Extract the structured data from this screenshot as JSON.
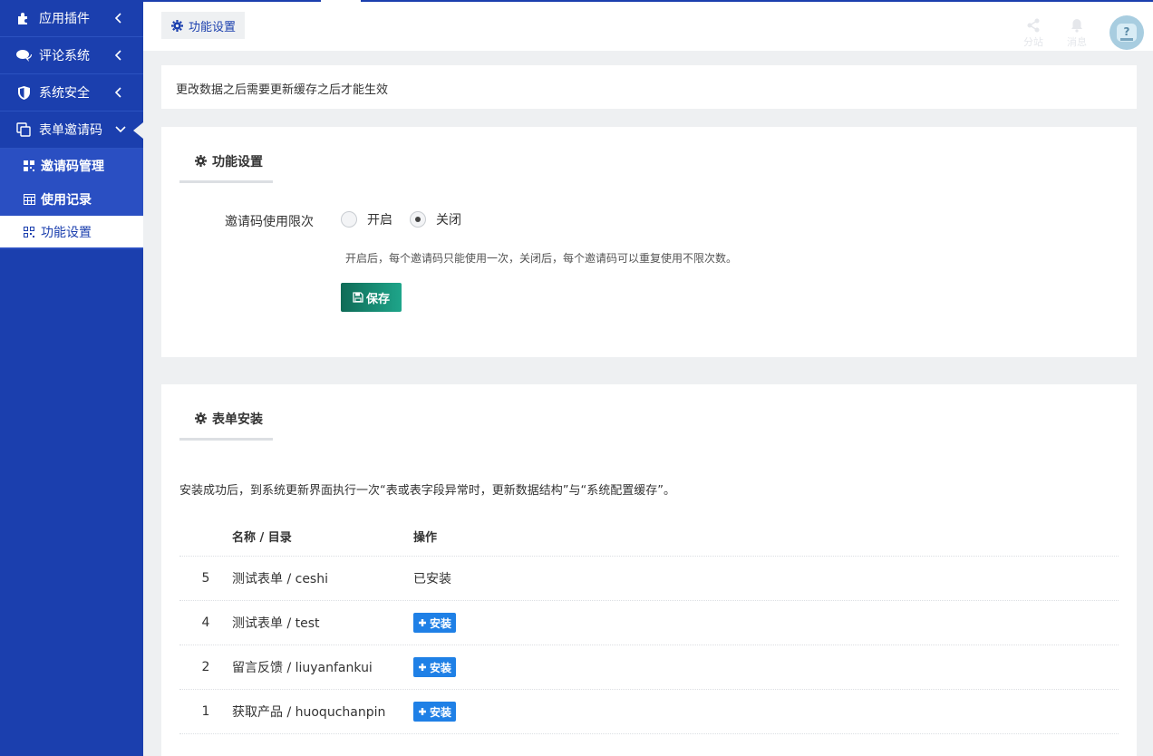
{
  "sidebar": {
    "items": [
      {
        "label": "应用插件",
        "icon": "puzzle-icon"
      },
      {
        "label": "评论系统",
        "icon": "comments-icon"
      },
      {
        "label": "系统安全",
        "icon": "shield-icon"
      },
      {
        "label": "表单邀请码",
        "icon": "copy-icon"
      }
    ],
    "submenu": [
      {
        "label": "邀请码管理",
        "icon": "qrcode-icon"
      },
      {
        "label": "使用记录",
        "icon": "calendar-icon"
      },
      {
        "label": "功能设置",
        "icon": "qrcode-icon"
      }
    ]
  },
  "header": {
    "tab_label": "功能设置",
    "actions": [
      {
        "label": "分站",
        "icon": "share-icon"
      },
      {
        "label": "消息",
        "icon": "bell-icon"
      }
    ]
  },
  "notice": "更改数据之后需要更新缓存之后才能生效",
  "settings": {
    "title": "功能设置",
    "field_label": "邀请码使用限次",
    "option_on": "开启",
    "option_off": "关闭",
    "selected": "关闭",
    "help": "开启后，每个邀请码只能使用一次，关闭后，每个邀请码可以重复使用不限次数。",
    "save_label": "保存"
  },
  "install": {
    "title": "表单安装",
    "note": "安装成功后，到系统更新界面执行一次“表或表字段异常时，更新数据结构”与“系统配置缓存”。",
    "columns": {
      "name": "名称 / 目录",
      "op": "操作"
    },
    "rows": [
      {
        "id": "5",
        "name": "测试表单 / ceshi",
        "op": "已安装"
      },
      {
        "id": "4",
        "name": "测试表单 / test",
        "op": "安装"
      },
      {
        "id": "2",
        "name": "留言反馈 / liuyanfankui",
        "op": "安装"
      },
      {
        "id": "1",
        "name": "获取产品 / huoquchanpin",
        "op": "安装"
      }
    ]
  },
  "colors": {
    "sidebar": "#1b3fae",
    "submenu": "#2a4fc2",
    "save": "#0f6b57",
    "install": "#1f80e6"
  }
}
